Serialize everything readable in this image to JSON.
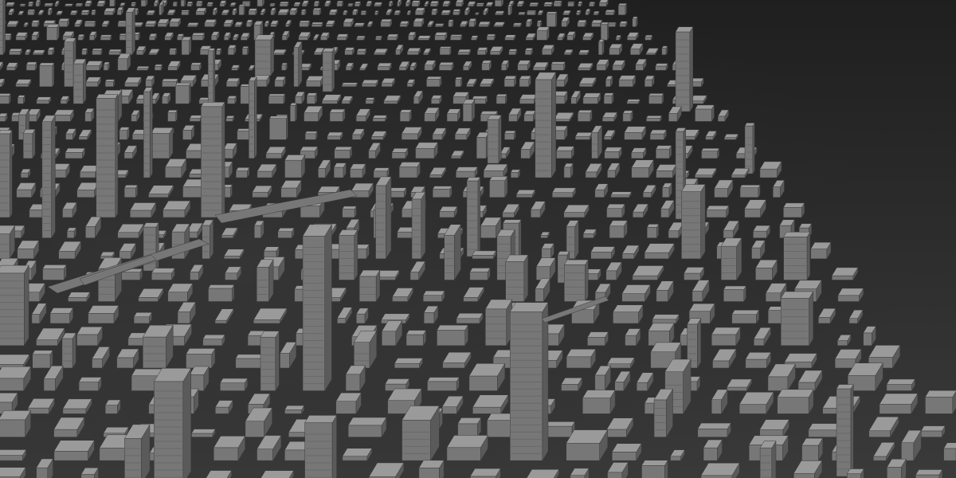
{
  "scene": {
    "background_top": "#1f1f1f",
    "background_bottom": "#3a3a3a",
    "block_color_light": "#9a9a9a",
    "block_color_mid": "#777777",
    "block_color_dark": "#5a5a5a"
  }
}
